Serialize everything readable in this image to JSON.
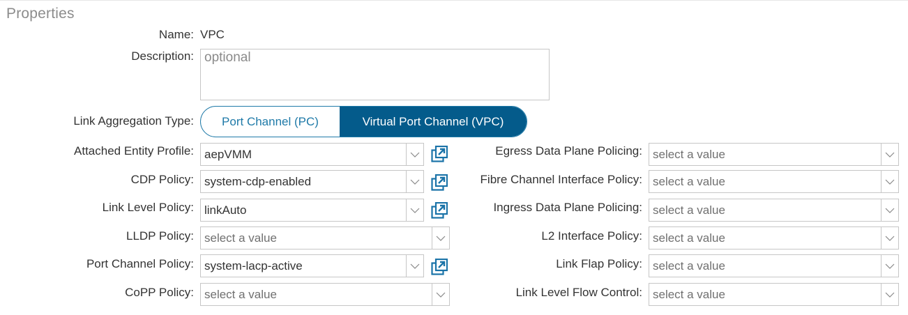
{
  "section_title": "Properties",
  "name": {
    "label": "Name:",
    "value": "VPC"
  },
  "description": {
    "label": "Description:",
    "placeholder": "optional"
  },
  "link_aggregation": {
    "label": "Link Aggregation Type:",
    "options": [
      "Port Channel (PC)",
      "Virtual Port Channel (VPC)"
    ],
    "selected": "Virtual Port Channel (VPC)"
  },
  "left_fields": [
    {
      "label": "Attached Entity Profile:",
      "value": "aepVMM"
    },
    {
      "label": "CDP Policy:",
      "value": "system-cdp-enabled"
    },
    {
      "label": "Link Level Policy:",
      "value": "linkAuto"
    },
    {
      "label": "LLDP Policy:",
      "value": "select a value"
    },
    {
      "label": "Port Channel Policy:",
      "value": "system-lacp-active"
    },
    {
      "label": "CoPP Policy:",
      "value": "select a value"
    }
  ],
  "right_fields": [
    {
      "label": "Egress Data Plane Policing:",
      "value": "select a value"
    },
    {
      "label": "Fibre Channel Interface Policy:",
      "value": "select a value"
    },
    {
      "label": "Ingress Data Plane Policing:",
      "value": "select a value"
    },
    {
      "label": "L2 Interface Policy:",
      "value": "select a value"
    },
    {
      "label": "Link Flap Policy:",
      "value": "select a value"
    },
    {
      "label": "Link Level Flow Control:",
      "value": "select a value"
    }
  ],
  "colors": {
    "accent": "#045b8b",
    "accent_light": "#1f7aa8",
    "border": "#c6c6c6"
  },
  "icons": {
    "dropdown": "chevron-down-icon",
    "open": "external-link-icon"
  }
}
